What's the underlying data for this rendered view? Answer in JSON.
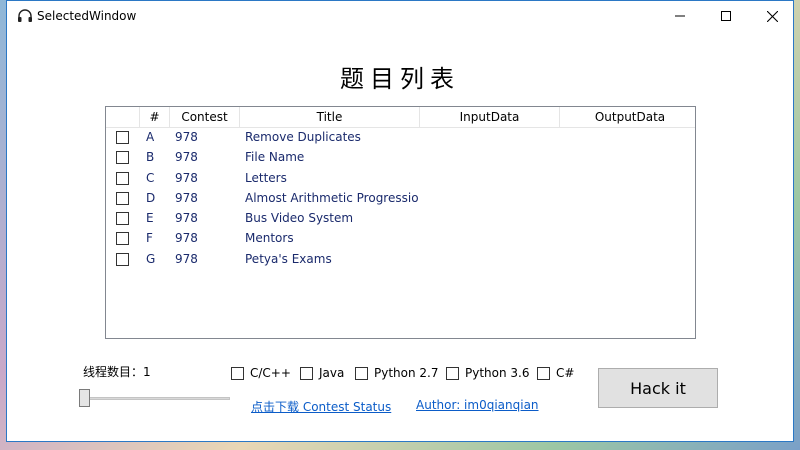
{
  "window": {
    "title": "SelectedWindow"
  },
  "page": {
    "heading": "题目列表"
  },
  "grid": {
    "columns": [
      "#",
      "Contest",
      "Title",
      "InputData",
      "OutputData"
    ],
    "rows": [
      {
        "id": "A",
        "contest": "978",
        "title": "Remove Duplicates",
        "checked": false
      },
      {
        "id": "B",
        "contest": "978",
        "title": "File Name",
        "checked": false
      },
      {
        "id": "C",
        "contest": "978",
        "title": "Letters",
        "checked": false
      },
      {
        "id": "D",
        "contest": "978",
        "title": "Almost Arithmetic Progressio",
        "checked": false
      },
      {
        "id": "E",
        "contest": "978",
        "title": "Bus Video System",
        "checked": false
      },
      {
        "id": "F",
        "contest": "978",
        "title": "Mentors",
        "checked": false
      },
      {
        "id": "G",
        "contest": "978",
        "title": "Petya's Exams",
        "checked": false
      }
    ]
  },
  "threads": {
    "label": "线程数目：1"
  },
  "languages": [
    {
      "label": "C/C++",
      "checked": false
    },
    {
      "label": "Java",
      "checked": false
    },
    {
      "label": "Python 2.7",
      "checked": false
    },
    {
      "label": "Python 3.6",
      "checked": false
    },
    {
      "label": "C#",
      "checked": false
    }
  ],
  "links": {
    "download": "点击下载 Contest Status",
    "author": "Author: im0qianqian"
  },
  "hack_button": "Hack it",
  "colors": {
    "link": "#0b5cc8",
    "row_text": "#1a2a6c",
    "border": "#2b78c5"
  }
}
